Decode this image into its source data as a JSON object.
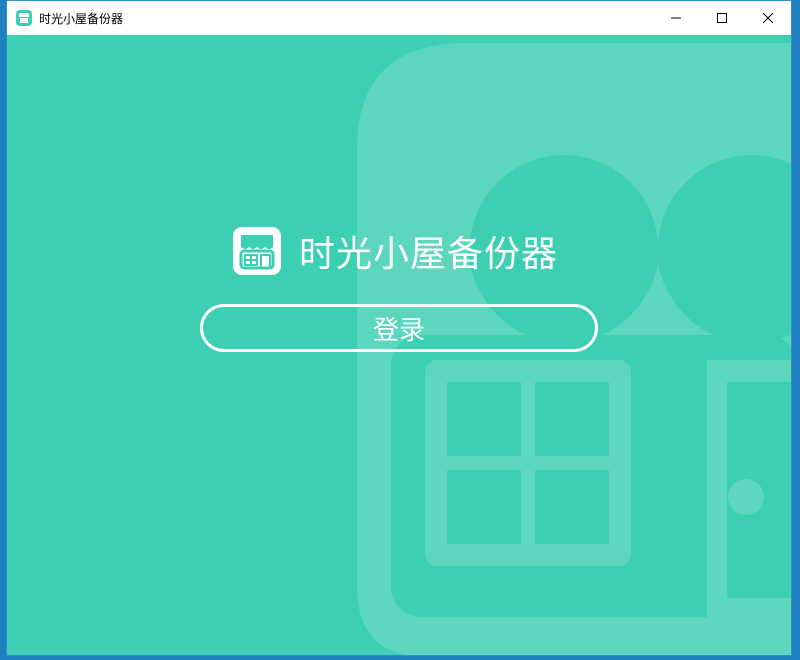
{
  "window": {
    "title": "时光小屋备份器",
    "controls": {
      "minimize_icon": "minimize-icon",
      "maximize_icon": "maximize-icon",
      "close_icon": "close-icon"
    }
  },
  "main": {
    "app_name": "时光小屋备份器",
    "login_label": "登录"
  },
  "colors": {
    "accent": "#3ccfb2",
    "watermark": "#5cd7be",
    "text": "#ffffff"
  },
  "icons": {
    "app_icon": "storefront-icon"
  }
}
